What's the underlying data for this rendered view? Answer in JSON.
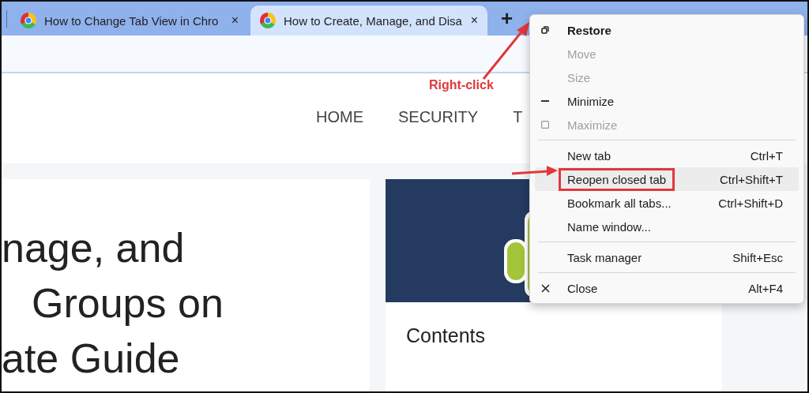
{
  "tabs": [
    {
      "title": "How to Change Tab View in Chro",
      "close": "×",
      "selected": false
    },
    {
      "title": "How to Create, Manage, and Disa",
      "close": "×",
      "selected": true
    }
  ],
  "new_tab_button": "+",
  "nav": [
    "HOME",
    "SECURITY",
    "T"
  ],
  "headline": [
    "nage, and",
    "Groups on",
    "ate Guide"
  ],
  "sidebar": {
    "contents_title": "Contents"
  },
  "annotation": "Right-click",
  "context_menu": [
    {
      "kind": "restore",
      "label": "Restore",
      "disabled": false,
      "selected": false
    },
    {
      "kind": "plain",
      "label": "Move",
      "disabled": true,
      "selected": false
    },
    {
      "kind": "plain",
      "label": "Size",
      "disabled": true,
      "selected": false
    },
    {
      "kind": "minimize",
      "label": "Minimize",
      "disabled": false,
      "selected": false
    },
    {
      "kind": "maximize",
      "label": "Maximize",
      "disabled": true,
      "selected": false
    },
    {
      "kind": "separator"
    },
    {
      "kind": "plain",
      "label": "New tab",
      "shortcut": "Ctrl+T",
      "disabled": false,
      "selected": false
    },
    {
      "kind": "plain",
      "label": "Reopen closed tab",
      "shortcut": "Ctrl+Shift+T",
      "disabled": false,
      "selected": true
    },
    {
      "kind": "plain",
      "label": "Bookmark all tabs...",
      "shortcut": "Ctrl+Shift+D",
      "disabled": false,
      "selected": false
    },
    {
      "kind": "plain",
      "label": "Name window...",
      "disabled": false,
      "selected": false
    },
    {
      "kind": "separator"
    },
    {
      "kind": "plain",
      "label": "Task manager",
      "shortcut": "Shift+Esc",
      "disabled": false,
      "selected": false
    },
    {
      "kind": "separator"
    },
    {
      "kind": "close",
      "label": "Close",
      "shortcut": "Alt+F4",
      "disabled": false,
      "selected": false
    }
  ]
}
